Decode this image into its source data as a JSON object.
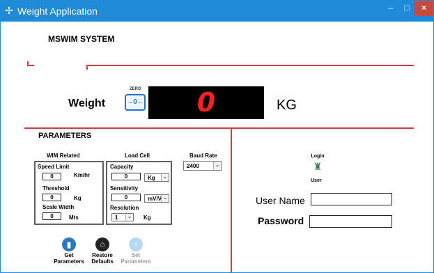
{
  "window": {
    "title": "Weight Application",
    "title_icon": "app-icon",
    "controls": {
      "minimize": "–",
      "maximize": "□",
      "close": "×"
    }
  },
  "main": {
    "system_title": "MSWIM SYSTEM",
    "weight_label": "Weight",
    "zero_label": "ZERO",
    "zero_icon_text": "→0←",
    "display_value": "0",
    "unit": "KG"
  },
  "parameters": {
    "title": "PARAMETERS",
    "wim": {
      "title": "WIM Related",
      "speed_limit_label": "Speed Limit",
      "speed_limit_value": "0",
      "speed_limit_unit": "Km/hr",
      "threshold_label": "Threshold",
      "threshold_value": "0",
      "threshold_unit": "Kg",
      "scale_width_label": "Scale Width",
      "scale_width_value": "0",
      "scale_width_unit": "Mts"
    },
    "load_cell": {
      "title": "Load Cell",
      "capacity_label": "Capacity",
      "capacity_value": "0",
      "capacity_unit": "Kg",
      "sensitivity_label": "Sensitivity",
      "sensitivity_value": "0",
      "sensitivity_unit": "mV/V",
      "resolution_label": "Resolution",
      "resolution_value": "1",
      "resolution_unit": "Kg"
    },
    "baud_rate": {
      "title": "Baud Rate",
      "value": "2400"
    },
    "actions": {
      "get_line1": "Get",
      "get_line2": "Parameters",
      "restore_line1": "Restore",
      "restore_line2": "Defaults",
      "set_line1": "Set",
      "set_line2": "Parameters"
    }
  },
  "login": {
    "title": "Login",
    "icon_label": "User",
    "username_label": "User Name",
    "password_label": "Password"
  },
  "colors": {
    "accent_red": "#d63a3a",
    "title_blue": "#1f8ad8"
  }
}
